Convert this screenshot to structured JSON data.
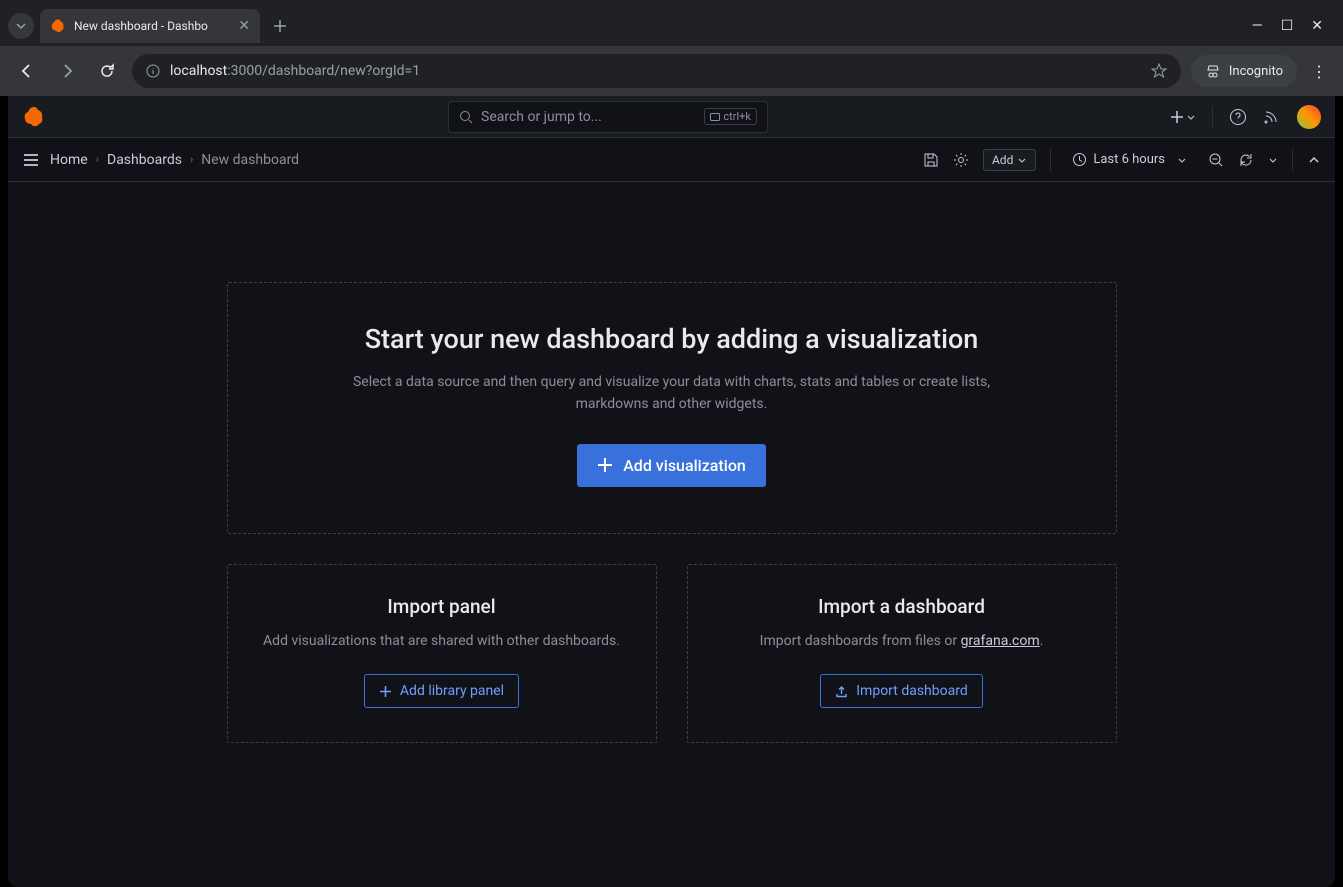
{
  "browser": {
    "tab_title": "New dashboard - Dashbo",
    "url_host": "localhost",
    "url_path": ":3000/dashboard/new?orgId=1",
    "incognito_label": "Incognito"
  },
  "header": {
    "search_placeholder": "Search or jump to...",
    "search_shortcut": "ctrl+k"
  },
  "toolbar": {
    "crumbs": {
      "home": "Home",
      "dashboards": "Dashboards",
      "current": "New dashboard"
    },
    "add_label": "Add",
    "time_label": "Last 6 hours"
  },
  "main": {
    "title": "Start your new dashboard by adding a visualization",
    "subtitle": "Select a data source and then query and visualize your data with charts, stats and tables or create lists, markdowns and other widgets.",
    "add_viz_label": "Add visualization"
  },
  "import_panel": {
    "title": "Import panel",
    "subtitle": "Add visualizations that are shared with other dashboards.",
    "button": "Add library panel"
  },
  "import_dash": {
    "title": "Import a dashboard",
    "subtitle_prefix": "Import dashboards from files or ",
    "subtitle_link": "grafana.com",
    "subtitle_suffix": ".",
    "button": "Import dashboard"
  }
}
